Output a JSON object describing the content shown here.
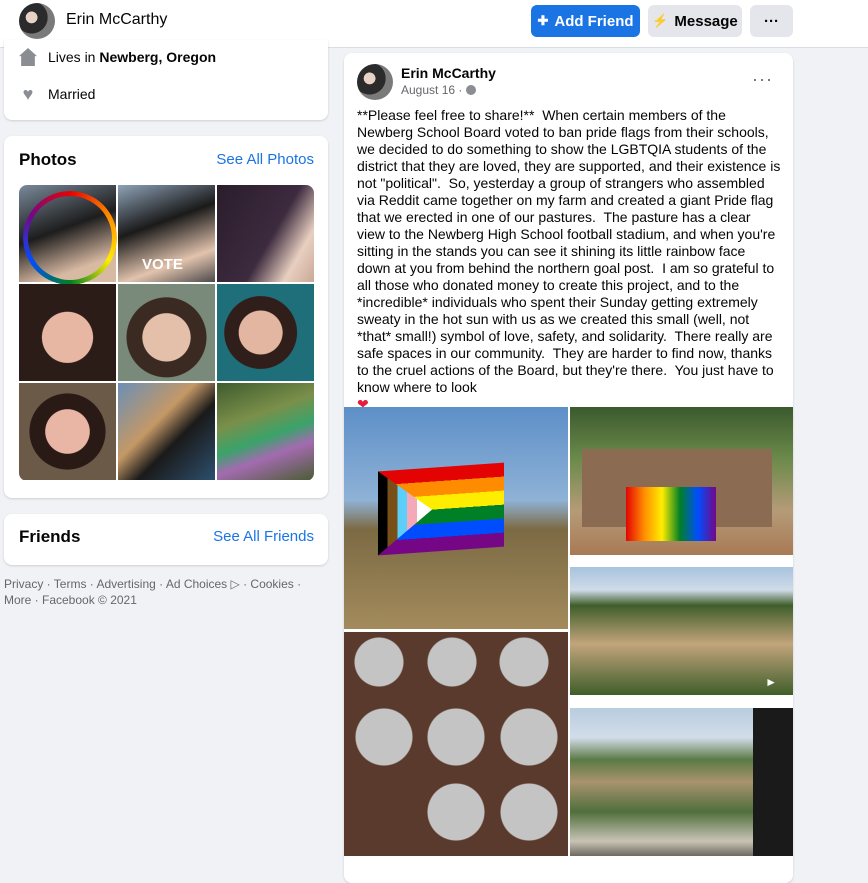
{
  "header": {
    "name": "Erin McCarthy",
    "add_friend": "Add Friend",
    "message": "Message",
    "more": "···"
  },
  "intro": {
    "lives_prefix": "Lives in ",
    "lives_place": "Newberg, Oregon",
    "relationship": "Married"
  },
  "photos": {
    "title": "Photos",
    "see_all": "See All Photos",
    "vote_text": "VOTE"
  },
  "friends": {
    "title": "Friends",
    "see_all": "See All Friends"
  },
  "footer": {
    "text": "Privacy · Terms · Advertising · Ad Choices ▷ · Cookies · More · Facebook © 2021"
  },
  "post": {
    "author": "Erin McCarthy",
    "date": "August 16 · ",
    "privacy_icon": "globe-icon",
    "options": "···",
    "text": "**Please feel free to share!**  When certain members of the Newberg School Board voted to ban pride flags from their schools, we decided to do something to show the LGBTQIA students of the district that they are loved, they are supported, and their existence is not \"political\".  So, yesterday a group of strangers who assembled via Reddit came together on my farm and created a giant Pride flag that we erected in one of our pastures.  The pasture has a clear view to the Newberg High School football stadium, and when you're sitting in the stands you can see it shining its little rainbow face down at you from behind the northern goal post.  I am so grateful to all those who donated money to create this project, and to the *incredible* individuals who spent their Sunday getting extremely sweaty in the hot sun with us as we created this small (well, not *that* small!) symbol of love, safety, and solidarity.  There really are safe spaces in our community.  They are harder to find now, thanks to the cruel actions of the Board, but they're there.  You just have to know where to look",
    "heart": "❤"
  },
  "colors": {
    "brand_blue": "#1b74e4",
    "background": "#f0f2f5",
    "secondary_text": "#65676b"
  }
}
